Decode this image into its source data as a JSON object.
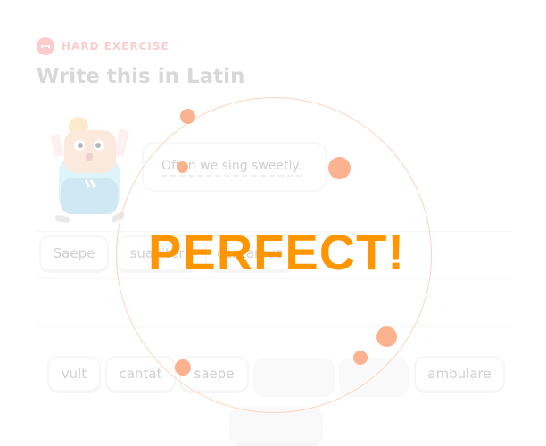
{
  "header": {
    "badge_label": "HARD EXERCISE",
    "badge_icon": "dumbbell-icon",
    "title": "Write this in Latin"
  },
  "prompt": {
    "sentence": "Often we sing sweetly."
  },
  "answer_tiles": [
    {
      "label": "Saepe"
    },
    {
      "label": "suaviter"
    },
    {
      "label": "cantamus"
    }
  ],
  "word_bank": {
    "tiles": [
      {
        "label": "vult"
      },
      {
        "label": "cantat"
      },
      {
        "label": "saepe"
      },
      {
        "label": ""
      },
      {
        "label": ""
      },
      {
        "label": "ambulare"
      },
      {
        "label": ""
      }
    ]
  },
  "feedback": {
    "text": "PERFECT!",
    "color": "#ff9600"
  },
  "colors": {
    "accent_orange": "#ff9600",
    "badge_pink": "#f7a6a6",
    "burst_peach": "#fbb38f"
  }
}
